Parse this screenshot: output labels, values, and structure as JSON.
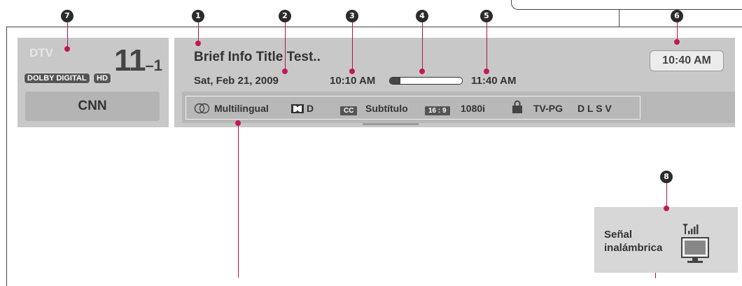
{
  "callouts": [
    "1",
    "2",
    "3",
    "4",
    "5",
    "6",
    "7",
    "8"
  ],
  "channel_panel": {
    "source": "DTV",
    "channel_major": "11",
    "channel_minor": "–1",
    "badges": [
      "DOLBY DIGITAL",
      "HD"
    ],
    "station_name": "CNN"
  },
  "info_panel": {
    "program_title": "Brief Info Title Test..",
    "date": "Sat, Feb 21, 2009",
    "start_time": "10:10 AM",
    "end_time": "11:40 AM",
    "progress_fraction": 0.15,
    "current_time": "10:40 AM"
  },
  "features": {
    "audio_label": "Multilingual",
    "dolby_suffix": "D",
    "cc_badge": "CC",
    "caption_label": "Subtítulo",
    "aspect_badge": "16 : 9",
    "resolution": "1080i",
    "rating": "TV-PG",
    "rating_flags": "D L S V"
  },
  "wireless": {
    "line1": "Señal",
    "line2": "inalámbrica"
  },
  "colors": {
    "panel": "#c8c8c8",
    "marker": "#c2185b",
    "callout": "#2b2b2b"
  }
}
